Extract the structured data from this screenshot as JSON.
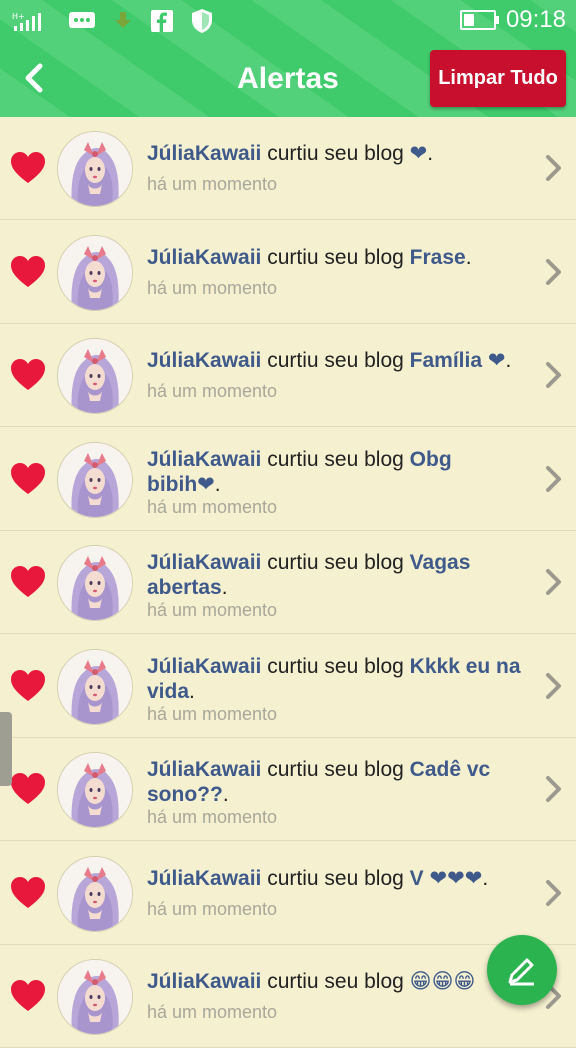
{
  "status_bar": {
    "time": "09:18",
    "icons": [
      "signal-icon",
      "message-icon",
      "download-icon",
      "facebook-icon",
      "shield-icon",
      "battery-icon"
    ]
  },
  "header": {
    "title": "Alertas",
    "clear_label": "Limpar Tudo",
    "bar_color": "#3fcb6b",
    "clear_color": "#c8102e"
  },
  "alerts": [
    {
      "user": "JúliaKawaii",
      "action": "curtiu seu blog",
      "blog_line1": "❤",
      "blog_line2": "",
      "end": ".",
      "time": "há um momento"
    },
    {
      "user": "JúliaKawaii",
      "action": "curtiu seu blog",
      "blog_line1": "Frase",
      "blog_line2": "",
      "end": ".",
      "time": "há um momento"
    },
    {
      "user": "JúliaKawaii",
      "action": "curtiu seu blog",
      "blog_line1": "Família ❤",
      "blog_line2": "",
      "end": ".",
      "time": "há um momento"
    },
    {
      "user": "JúliaKawaii",
      "action": "curtiu seu blog",
      "blog_line1": "Obg",
      "blog_line2": "bibih❤",
      "end": ".",
      "time": "há um momento"
    },
    {
      "user": "JúliaKawaii",
      "action": "curtiu seu blog",
      "blog_line1": "Vagas",
      "blog_line2": "abertas",
      "end": ".",
      "time": "há um momento"
    },
    {
      "user": "JúliaKawaii",
      "action": "curtiu seu blog",
      "blog_line1": "Kkkk eu na",
      "blog_line2": "vida",
      "end": ".",
      "time": "há um momento"
    },
    {
      "user": "JúliaKawaii",
      "action": "curtiu seu blog",
      "blog_line1": "Cadê vc",
      "blog_line2": "sono??",
      "end": ".",
      "time": "há um momento"
    },
    {
      "user": "JúliaKawaii",
      "action": "curtiu seu blog",
      "blog_line1": "V ❤❤❤",
      "blog_line2": "",
      "end": ".",
      "time": "há um momento"
    },
    {
      "user": "JúliaKawaii",
      "action": "curtiu seu blog",
      "blog_line1": "😁😁😁",
      "blog_line2": "",
      "end": "",
      "time": "há um momento"
    }
  ],
  "fab_icon": "pencil-icon"
}
